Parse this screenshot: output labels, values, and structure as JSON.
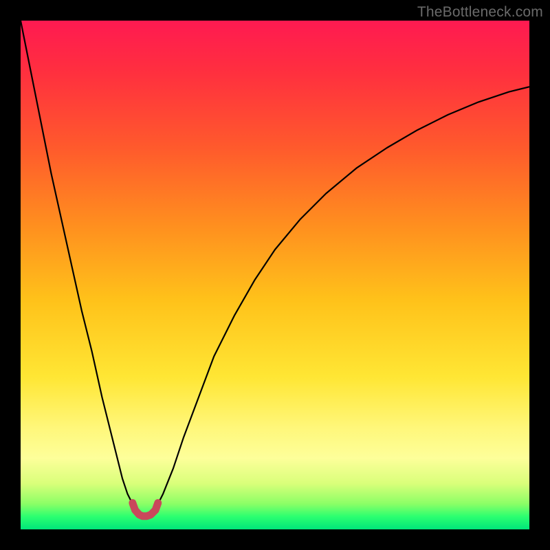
{
  "watermark": "TheBottleneck.com",
  "chart_data": {
    "type": "line",
    "title": "",
    "xlabel": "",
    "ylabel": "",
    "xlim": [
      0,
      100
    ],
    "ylim": [
      0,
      100
    ],
    "background_gradient": {
      "stops": [
        {
          "offset": 0.0,
          "color": "#ff1a51"
        },
        {
          "offset": 0.1,
          "color": "#ff2f3f"
        },
        {
          "offset": 0.25,
          "color": "#ff5a2c"
        },
        {
          "offset": 0.4,
          "color": "#ff8e1f"
        },
        {
          "offset": 0.55,
          "color": "#ffc21a"
        },
        {
          "offset": 0.7,
          "color": "#ffe634"
        },
        {
          "offset": 0.8,
          "color": "#fff77a"
        },
        {
          "offset": 0.86,
          "color": "#fdff9a"
        },
        {
          "offset": 0.91,
          "color": "#d9ff7a"
        },
        {
          "offset": 0.95,
          "color": "#8bff66"
        },
        {
          "offset": 0.975,
          "color": "#2bff70"
        },
        {
          "offset": 1.0,
          "color": "#00e57a"
        }
      ]
    },
    "series": [
      {
        "name": "left-curve",
        "color": "#000000",
        "width": 2.2,
        "x": [
          0,
          2,
          4,
          6,
          8,
          10,
          12,
          14,
          16,
          18,
          19,
          20,
          21,
          22,
          23
        ],
        "y": [
          100,
          90,
          80,
          70,
          61,
          52,
          43,
          35,
          26,
          18,
          14,
          10,
          7,
          5,
          4
        ]
      },
      {
        "name": "right-curve",
        "color": "#000000",
        "width": 2.2,
        "x": [
          26,
          27,
          28,
          30,
          32,
          35,
          38,
          42,
          46,
          50,
          55,
          60,
          66,
          72,
          78,
          84,
          90,
          96,
          100
        ],
        "y": [
          4,
          5,
          7,
          12,
          18,
          26,
          34,
          42,
          49,
          55,
          61,
          66,
          71,
          75,
          78.5,
          81.5,
          84,
          86,
          87
        ]
      },
      {
        "name": "valley-marker",
        "color": "#C9485B",
        "width": 11,
        "linecap": "round",
        "x": [
          22.0,
          22.5,
          23.3,
          24.0,
          24.8,
          25.6,
          26.5,
          27.0
        ],
        "y": [
          5.2,
          3.8,
          2.9,
          2.6,
          2.6,
          2.9,
          3.8,
          5.2
        ]
      }
    ]
  }
}
